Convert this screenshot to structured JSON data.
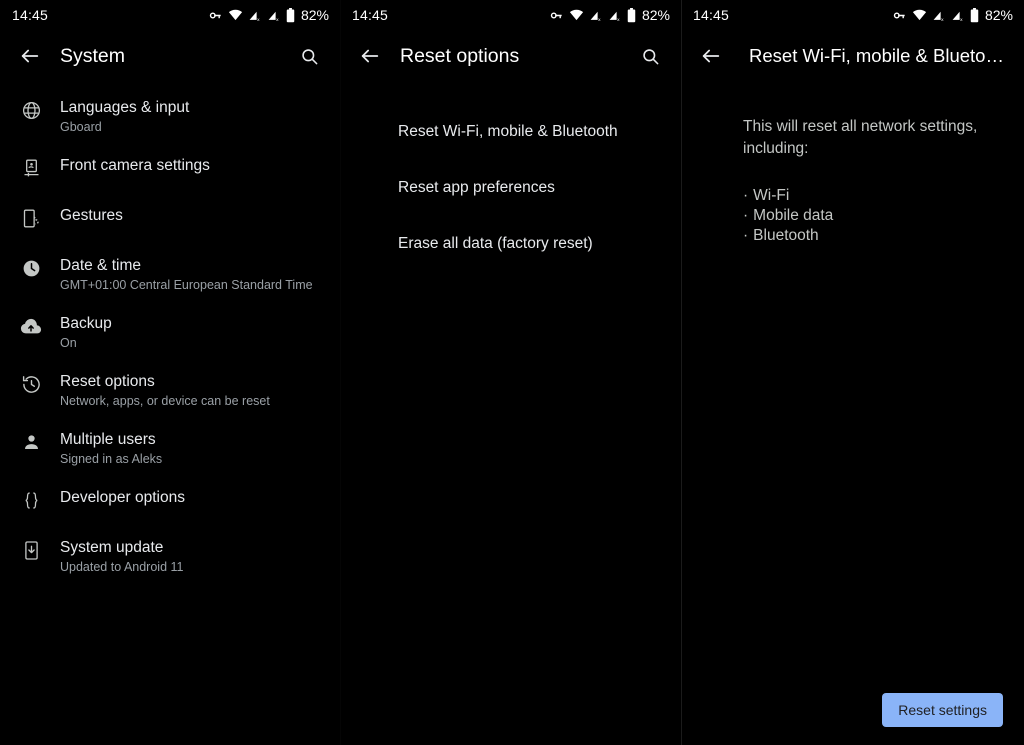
{
  "statusbar": {
    "time": "14:45",
    "battery_text": "82%",
    "icons": [
      "vpn-key-icon",
      "wifi-icon",
      "signal-1-icon",
      "signal-2-icon",
      "battery-icon"
    ]
  },
  "panel_system": {
    "title": "System",
    "back_icon": "back-arrow-icon",
    "search_icon": "search-icon",
    "items": [
      {
        "icon": "globe-icon",
        "title": "Languages & input",
        "subtitle": "Gboard"
      },
      {
        "icon": "front-camera-icon",
        "title": "Front camera settings",
        "subtitle": ""
      },
      {
        "icon": "gestures-icon",
        "title": "Gestures",
        "subtitle": ""
      },
      {
        "icon": "clock-icon",
        "title": "Date & time",
        "subtitle": "GMT+01:00 Central European Standard Time"
      },
      {
        "icon": "cloud-upload-icon",
        "title": "Backup",
        "subtitle": "On"
      },
      {
        "icon": "history-icon",
        "title": "Reset options",
        "subtitle": "Network, apps, or device can be reset"
      },
      {
        "icon": "person-icon",
        "title": "Multiple users",
        "subtitle": "Signed in as Aleks"
      },
      {
        "icon": "braces-icon",
        "title": "Developer options",
        "subtitle": ""
      },
      {
        "icon": "system-update-icon",
        "title": "System update",
        "subtitle": "Updated to Android 11"
      }
    ]
  },
  "panel_reset_options": {
    "title": "Reset options",
    "back_icon": "back-arrow-icon",
    "search_icon": "search-icon",
    "items": [
      {
        "title": "Reset Wi-Fi, mobile & Bluetooth"
      },
      {
        "title": "Reset app preferences"
      },
      {
        "title": "Erase all data (factory reset)"
      }
    ]
  },
  "panel_reset_network": {
    "title": "Reset Wi-Fi, mobile & Blueto…",
    "back_icon": "back-arrow-icon",
    "description": "This will reset all network settings, including:",
    "bullets": [
      "Wi-Fi",
      "Mobile data",
      "Bluetooth"
    ],
    "button_label": "Reset settings",
    "button_color": "#8ab4f8",
    "button_text_color": "#202124"
  }
}
